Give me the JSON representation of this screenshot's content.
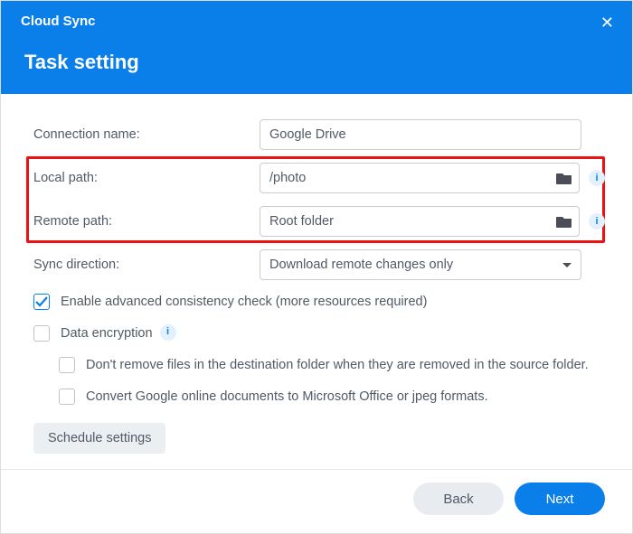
{
  "app_title": "Cloud Sync",
  "page_title": "Task setting",
  "fields": {
    "connection_name": {
      "label": "Connection name:",
      "value": "Google Drive"
    },
    "local_path": {
      "label": "Local path:",
      "value": "/photo"
    },
    "remote_path": {
      "label": "Remote path:",
      "value": "Root folder"
    },
    "sync_direction": {
      "label": "Sync direction:",
      "value": "Download remote changes only"
    }
  },
  "checkboxes": {
    "consistency": {
      "checked": true,
      "label": "Enable advanced consistency check (more resources required)"
    },
    "encryption": {
      "checked": false,
      "label": "Data encryption"
    },
    "dont_remove": {
      "checked": false,
      "label": "Don't remove files in the destination folder when they are removed in the source folder."
    },
    "convert": {
      "checked": false,
      "label": "Convert Google online documents to Microsoft Office or jpeg formats."
    }
  },
  "buttons": {
    "schedule": "Schedule settings",
    "back": "Back",
    "next": "Next"
  },
  "colors": {
    "accent": "#0a7fea",
    "highlight": "#e11"
  }
}
